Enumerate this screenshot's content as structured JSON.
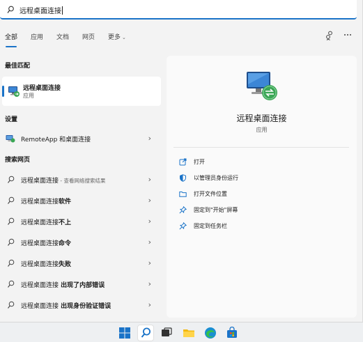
{
  "search": {
    "query": "远程桌面连接"
  },
  "tabs": [
    {
      "label": "全部"
    },
    {
      "label": "应用"
    },
    {
      "label": "文档"
    },
    {
      "label": "网页"
    },
    {
      "label": "更多"
    }
  ],
  "sections": {
    "best_match": "最佳匹配",
    "settings": "设置",
    "web": "搜索网页"
  },
  "best_match": {
    "title": "远程桌面连接",
    "subtitle": "应用"
  },
  "settings_items": [
    {
      "label": "RemoteApp 和桌面连接"
    }
  ],
  "web_results": [
    {
      "prefix": "远程桌面连接",
      "suffix": " - 查看网络搜索结果"
    },
    {
      "prefix": "远程桌面连接",
      "suffix": "软件"
    },
    {
      "prefix": "远程桌面连接",
      "suffix": "不上"
    },
    {
      "prefix": "远程桌面连接",
      "suffix": "命令"
    },
    {
      "prefix": "远程桌面连接",
      "suffix": "失败"
    },
    {
      "prefix": "远程桌面连接",
      "suffix": " 出现了内部错误"
    },
    {
      "prefix": "远程桌面连接",
      "suffix": " 出现身份验证错误"
    }
  ],
  "detail": {
    "title": "远程桌面连接",
    "subtitle": "应用",
    "actions": [
      {
        "label": "打开",
        "icon": "open-icon"
      },
      {
        "label": "以管理员身份运行",
        "icon": "shield-icon"
      },
      {
        "label": "打开文件位置",
        "icon": "folder-icon"
      },
      {
        "label": "固定到\"开始\"屏幕",
        "icon": "pin-icon"
      },
      {
        "label": "固定到任务栏",
        "icon": "pin-icon"
      }
    ]
  },
  "colors": {
    "accent": "#1a73c8",
    "panel": "#f3f3f3",
    "detail": "#fafafa"
  },
  "taskbar": {
    "items": [
      "start-icon",
      "search-icon",
      "task-view-icon",
      "file-explorer-icon",
      "edge-icon",
      "store-icon"
    ]
  }
}
